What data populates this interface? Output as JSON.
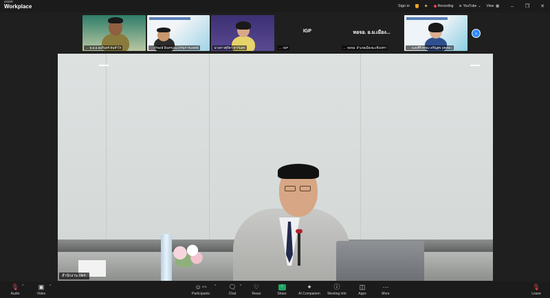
{
  "app": {
    "brand_small": "zoom",
    "brand_name": "Workplace"
  },
  "titlebar": {
    "sign_in": "Sign in",
    "recording": "Recording",
    "youtube": "YouTube",
    "view": "View",
    "minimize": "–",
    "restore": "❐",
    "close": "✕"
  },
  "participants_strip": [
    {
      "name": "พ.อ.อ.อมรินทร์ สันทำไร",
      "video": true,
      "muted": true
    },
    {
      "name": "ธีรพงษ์ อินทรเมฆ (กรมการแพทย์)",
      "video": true,
      "muted": true
    },
    {
      "name": "นางสาวศุภิดา หากันสุข",
      "video": true,
      "muted": false
    },
    {
      "name": "IGP",
      "video": false,
      "muted": true
    },
    {
      "name": "หอจอ. อำเภอเมืองฉะเชิงเทรา",
      "display_name": "หอจอ. อ.ม.เมือง...",
      "video": false,
      "muted": true
    },
    {
      "name": "น.ส.ศิริวรรณ เจริญสุข (สพรส.)",
      "video": true,
      "muted": true
    }
  ],
  "main_video": {
    "speaker_label": "สำนักงาน กพร."
  },
  "toolbar": {
    "audio": "Audio",
    "video": "Video",
    "participants": "Participants",
    "participant_count": "976",
    "chat": "Chat",
    "react": "React",
    "share": "Share",
    "ai_companion": "AI Companion",
    "meeting_info": "Meeting info",
    "apps": "Apps",
    "more": "More",
    "leave": "Leave"
  },
  "colors": {
    "accent": "#2d8cff",
    "danger": "#e5484d",
    "share": "#1fa463",
    "bar": "#1b1b1b"
  }
}
